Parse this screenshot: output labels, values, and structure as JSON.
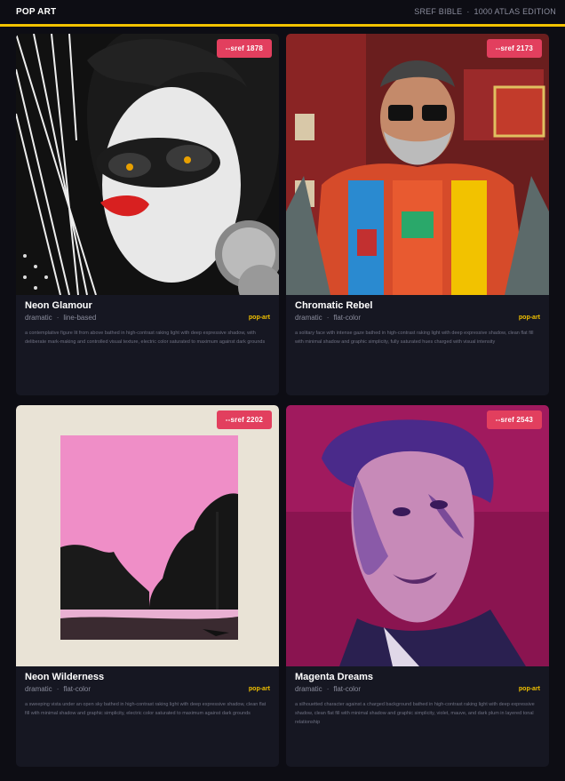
{
  "header": {
    "brand": "POP ART",
    "edition_left": "SREF BIBLE",
    "edition_right": "1000 ATLAS EDITION"
  },
  "colors": {
    "accent": "#f2c200",
    "badge": "#e23f5e",
    "background": "#0d0d14",
    "card": "#161722"
  },
  "cards": [
    {
      "sref": "--sref 1878",
      "title": "Neon Glamour",
      "meta1": "dramatic",
      "meta2": "line-based",
      "tag": "pop-art",
      "desc": "a contemplative figure lit from above bathed in high-contrast raking light with deep expressive shadow, with deliberate mark-making and controlled visual texture, electric color saturated to maximum against dark grounds"
    },
    {
      "sref": "--sref 2173",
      "title": "Chromatic Rebel",
      "meta1": "dramatic",
      "meta2": "flat-color",
      "tag": "pop-art",
      "desc": "a solitary face with intense gaze bathed in high-contrast raking light with deep expressive shadow, clean flat fill with minimal shadow and graphic simplicity, fully saturated hues charged with visual intensity"
    },
    {
      "sref": "--sref 2202",
      "title": "Neon Wilderness",
      "meta1": "dramatic",
      "meta2": "flat-color",
      "tag": "pop-art",
      "desc": "a sweeping vista under an open sky bathed in high-contrast raking light with deep expressive shadow, clean flat fill with minimal shadow and graphic simplicity, electric color saturated to maximum against dark grounds"
    },
    {
      "sref": "--sref 2543",
      "title": "Magenta Dreams",
      "meta1": "dramatic",
      "meta2": "flat-color",
      "tag": "pop-art",
      "desc": "a silhouetted character against a charged background bathed in high-contrast raking light with deep expressive shadow, clean flat fill with minimal shadow and graphic simplicity, violet, mauve, and dark plum in layered tonal relationship"
    }
  ]
}
